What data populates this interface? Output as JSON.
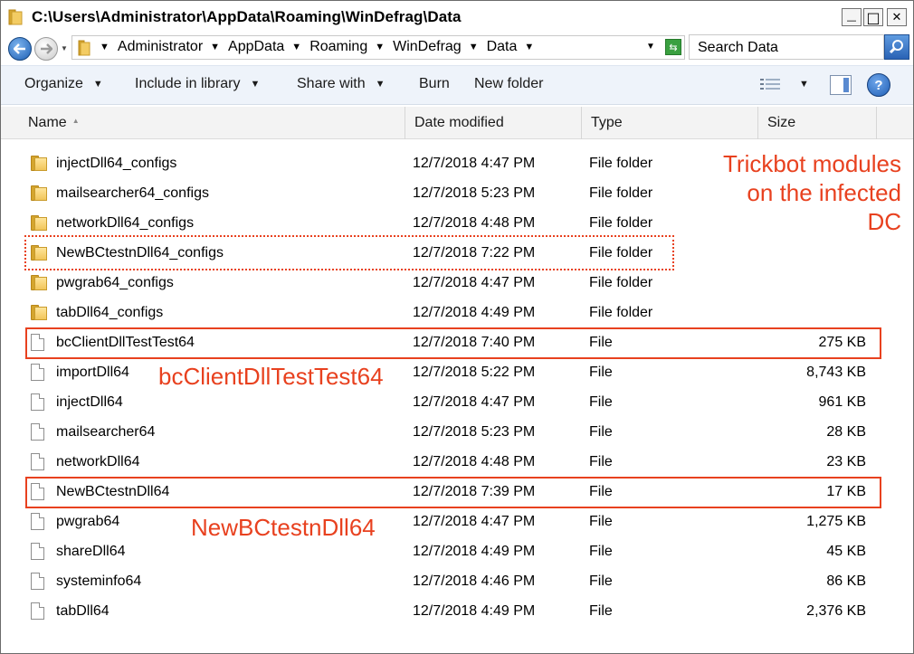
{
  "window": {
    "title": "C:\\Users\\Administrator\\AppData\\Roaming\\WinDefrag\\Data",
    "minimize_glyph": "—",
    "maximize_glyph": "□",
    "close_glyph": "✕"
  },
  "address": {
    "breadcrumbs": [
      "Administrator",
      "AppData",
      "Roaming",
      "WinDefrag",
      "Data"
    ],
    "search_placeholder": "Search Data"
  },
  "toolbar": {
    "organize": "Organize",
    "include_in_library": "Include in library",
    "share_with": "Share with",
    "burn": "Burn",
    "new_folder": "New folder",
    "help_glyph": "?"
  },
  "columns": {
    "name": "Name",
    "date_modified": "Date modified",
    "type": "Type",
    "size": "Size"
  },
  "files": [
    {
      "name": "injectDll64_configs",
      "date": "12/7/2018 4:47 PM",
      "type": "File folder",
      "size": "",
      "icon": "folder-icon"
    },
    {
      "name": "mailsearcher64_configs",
      "date": "12/7/2018 5:23 PM",
      "type": "File folder",
      "size": "",
      "icon": "folder-icon"
    },
    {
      "name": "networkDll64_configs",
      "date": "12/7/2018 4:48 PM",
      "type": "File folder",
      "size": "",
      "icon": "folder-icon"
    },
    {
      "name": "NewBCtestnDll64_configs",
      "date": "12/7/2018 7:22 PM",
      "type": "File folder",
      "size": "",
      "icon": "folder-icon"
    },
    {
      "name": "pwgrab64_configs",
      "date": "12/7/2018 4:47 PM",
      "type": "File folder",
      "size": "",
      "icon": "folder-icon"
    },
    {
      "name": "tabDll64_configs",
      "date": "12/7/2018 4:49 PM",
      "type": "File folder",
      "size": "",
      "icon": "folder-icon"
    },
    {
      "name": "bcClientDllTestTest64",
      "date": "12/7/2018 7:40 PM",
      "type": "File",
      "size": "275 KB",
      "icon": "file-icon"
    },
    {
      "name": "importDll64",
      "date": "12/7/2018 5:22 PM",
      "type": "File",
      "size": "8,743 KB",
      "icon": "file-icon"
    },
    {
      "name": "injectDll64",
      "date": "12/7/2018 4:47 PM",
      "type": "File",
      "size": "961 KB",
      "icon": "file-icon"
    },
    {
      "name": "mailsearcher64",
      "date": "12/7/2018 5:23 PM",
      "type": "File",
      "size": "28 KB",
      "icon": "file-icon"
    },
    {
      "name": "networkDll64",
      "date": "12/7/2018 4:48 PM",
      "type": "File",
      "size": "23 KB",
      "icon": "file-icon"
    },
    {
      "name": "NewBCtestnDll64",
      "date": "12/7/2018 7:39 PM",
      "type": "File",
      "size": "17 KB",
      "icon": "file-icon"
    },
    {
      "name": "pwgrab64",
      "date": "12/7/2018 4:47 PM",
      "type": "File",
      "size": "1,275 KB",
      "icon": "file-icon"
    },
    {
      "name": "shareDll64",
      "date": "12/7/2018 4:49 PM",
      "type": "File",
      "size": "45 KB",
      "icon": "file-icon"
    },
    {
      "name": "systeminfo64",
      "date": "12/7/2018 4:46 PM",
      "type": "File",
      "size": "86 KB",
      "icon": "file-icon"
    },
    {
      "name": "tabDll64",
      "date": "12/7/2018 4:49 PM",
      "type": "File",
      "size": "2,376 KB",
      "icon": "file-icon"
    }
  ],
  "annotations": {
    "heading_lines": [
      "Trickbot modules",
      "on the infected",
      "DC"
    ],
    "label_bcclient": "bcClientDllTestTest64",
    "label_newbc": "NewBCtestnDll64",
    "color": "#e8411f"
  }
}
